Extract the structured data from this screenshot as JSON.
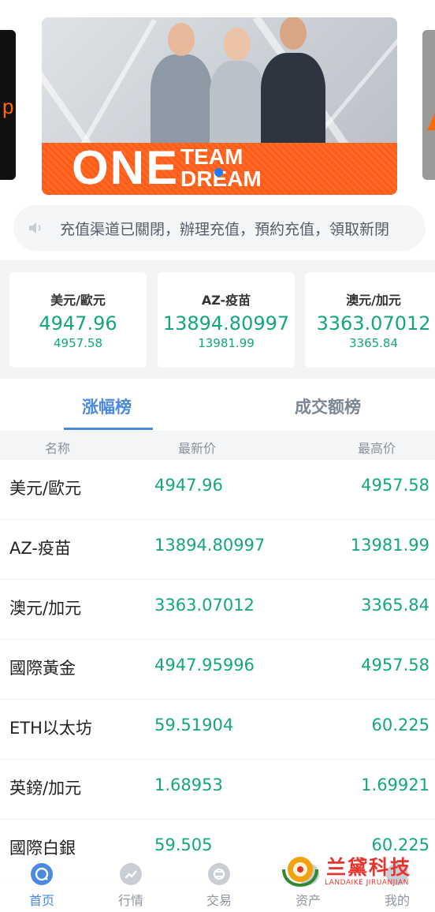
{
  "banner": {
    "brand_big": "ONE",
    "brand_small_top": "TEAM",
    "brand_small_bottom": "DREAM"
  },
  "notice": {
    "icon": "speaker-icon",
    "text": "充值渠道已關閉，辦理充值，預約充值，領取新閉"
  },
  "cards": [
    {
      "name": "美元/歐元",
      "price": "4947.96",
      "high": "4957.58"
    },
    {
      "name": "AZ-疫苗",
      "price": "13894.80997",
      "high": "13981.99"
    },
    {
      "name": "澳元/加元",
      "price": "3363.07012",
      "high": "3365.84"
    }
  ],
  "tabs": {
    "gainers": "涨幅榜",
    "volume": "成交额榜"
  },
  "table": {
    "headers": {
      "name": "名称",
      "latest": "最新价",
      "high": "最高价"
    },
    "rows": [
      {
        "name": "美元/歐元",
        "latest": "4947.96",
        "high": "4957.58"
      },
      {
        "name": "AZ-疫苗",
        "latest": "13894.80997",
        "high": "13981.99"
      },
      {
        "name": "澳元/加元",
        "latest": "3363.07012",
        "high": "3365.84"
      },
      {
        "name": "國際黃金",
        "latest": "4947.95996",
        "high": "4957.58"
      },
      {
        "name": "ETH以太坊",
        "latest": "59.51904",
        "high": "60.225"
      },
      {
        "name": "英鎊/加元",
        "latest": "1.68953",
        "high": "1.69921"
      },
      {
        "name": "國際白銀",
        "latest": "59.505",
        "high": "60.225"
      }
    ]
  },
  "nav": [
    {
      "label": "首页",
      "icon": "home-icon",
      "active": true
    },
    {
      "label": "行情",
      "icon": "market-trend-icon",
      "active": false
    },
    {
      "label": "交易",
      "icon": "exchange-icon",
      "active": false
    },
    {
      "label": "资产",
      "icon": "wallet-icon",
      "active": false
    },
    {
      "label": "我的",
      "icon": "user-icon",
      "active": false
    }
  ],
  "watermark": {
    "title": "兰黛科技",
    "subtitle": "LANDAIKE JIRUANJIAN"
  },
  "colors": {
    "accent": "#4a8ae0",
    "up": "#13a681",
    "banner_orange": "#ff5a17"
  }
}
